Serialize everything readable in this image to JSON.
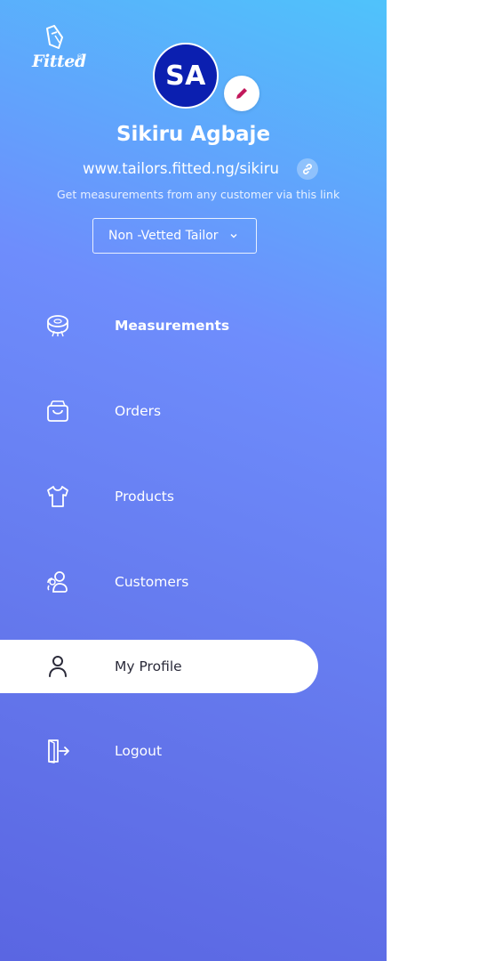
{
  "brand": {
    "name": "Fitted",
    "reg": "®"
  },
  "profile": {
    "initials": "SA",
    "name": "Sikiru Agbaje",
    "link": "www.tailors.fitted.ng/sikiru",
    "hint": "Get measurements from any customer via this link",
    "status": "Non -Vetted Tailor"
  },
  "menu": [
    {
      "label": "Measurements",
      "icon": "tape-measure-icon"
    },
    {
      "label": "Orders",
      "icon": "shopping-bag-icon"
    },
    {
      "label": "Products",
      "icon": "shirt-icon"
    },
    {
      "label": "Customers",
      "icon": "users-icon"
    },
    {
      "label": "My Profile",
      "icon": "user-icon",
      "active": true
    },
    {
      "label": "Logout",
      "icon": "logout-icon"
    }
  ],
  "colors": {
    "accent_edit": "#c2185b",
    "avatar_bg": "#0b1fb0",
    "gradient_top": "#4fc3fb",
    "gradient_bottom": "#5a66e2"
  }
}
